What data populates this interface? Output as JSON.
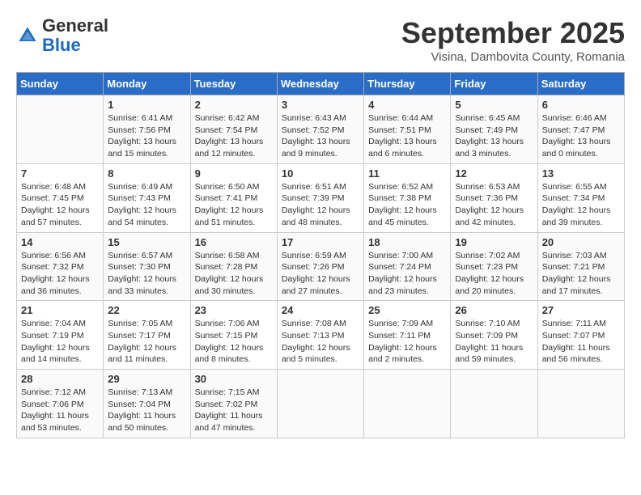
{
  "header": {
    "logo_general": "General",
    "logo_blue": "Blue",
    "month_title": "September 2025",
    "location": "Visina, Dambovita County, Romania"
  },
  "weekdays": [
    "Sunday",
    "Monday",
    "Tuesday",
    "Wednesday",
    "Thursday",
    "Friday",
    "Saturday"
  ],
  "weeks": [
    [
      {
        "day": "",
        "empty": true
      },
      {
        "day": "1",
        "sunrise": "Sunrise: 6:41 AM",
        "sunset": "Sunset: 7:56 PM",
        "daylight": "Daylight: 13 hours and 15 minutes."
      },
      {
        "day": "2",
        "sunrise": "Sunrise: 6:42 AM",
        "sunset": "Sunset: 7:54 PM",
        "daylight": "Daylight: 13 hours and 12 minutes."
      },
      {
        "day": "3",
        "sunrise": "Sunrise: 6:43 AM",
        "sunset": "Sunset: 7:52 PM",
        "daylight": "Daylight: 13 hours and 9 minutes."
      },
      {
        "day": "4",
        "sunrise": "Sunrise: 6:44 AM",
        "sunset": "Sunset: 7:51 PM",
        "daylight": "Daylight: 13 hours and 6 minutes."
      },
      {
        "day": "5",
        "sunrise": "Sunrise: 6:45 AM",
        "sunset": "Sunset: 7:49 PM",
        "daylight": "Daylight: 13 hours and 3 minutes."
      },
      {
        "day": "6",
        "sunrise": "Sunrise: 6:46 AM",
        "sunset": "Sunset: 7:47 PM",
        "daylight": "Daylight: 13 hours and 0 minutes."
      }
    ],
    [
      {
        "day": "7",
        "sunrise": "Sunrise: 6:48 AM",
        "sunset": "Sunset: 7:45 PM",
        "daylight": "Daylight: 12 hours and 57 minutes."
      },
      {
        "day": "8",
        "sunrise": "Sunrise: 6:49 AM",
        "sunset": "Sunset: 7:43 PM",
        "daylight": "Daylight: 12 hours and 54 minutes."
      },
      {
        "day": "9",
        "sunrise": "Sunrise: 6:50 AM",
        "sunset": "Sunset: 7:41 PM",
        "daylight": "Daylight: 12 hours and 51 minutes."
      },
      {
        "day": "10",
        "sunrise": "Sunrise: 6:51 AM",
        "sunset": "Sunset: 7:39 PM",
        "daylight": "Daylight: 12 hours and 48 minutes."
      },
      {
        "day": "11",
        "sunrise": "Sunrise: 6:52 AM",
        "sunset": "Sunset: 7:38 PM",
        "daylight": "Daylight: 12 hours and 45 minutes."
      },
      {
        "day": "12",
        "sunrise": "Sunrise: 6:53 AM",
        "sunset": "Sunset: 7:36 PM",
        "daylight": "Daylight: 12 hours and 42 minutes."
      },
      {
        "day": "13",
        "sunrise": "Sunrise: 6:55 AM",
        "sunset": "Sunset: 7:34 PM",
        "daylight": "Daylight: 12 hours and 39 minutes."
      }
    ],
    [
      {
        "day": "14",
        "sunrise": "Sunrise: 6:56 AM",
        "sunset": "Sunset: 7:32 PM",
        "daylight": "Daylight: 12 hours and 36 minutes."
      },
      {
        "day": "15",
        "sunrise": "Sunrise: 6:57 AM",
        "sunset": "Sunset: 7:30 PM",
        "daylight": "Daylight: 12 hours and 33 minutes."
      },
      {
        "day": "16",
        "sunrise": "Sunrise: 6:58 AM",
        "sunset": "Sunset: 7:28 PM",
        "daylight": "Daylight: 12 hours and 30 minutes."
      },
      {
        "day": "17",
        "sunrise": "Sunrise: 6:59 AM",
        "sunset": "Sunset: 7:26 PM",
        "daylight": "Daylight: 12 hours and 27 minutes."
      },
      {
        "day": "18",
        "sunrise": "Sunrise: 7:00 AM",
        "sunset": "Sunset: 7:24 PM",
        "daylight": "Daylight: 12 hours and 23 minutes."
      },
      {
        "day": "19",
        "sunrise": "Sunrise: 7:02 AM",
        "sunset": "Sunset: 7:23 PM",
        "daylight": "Daylight: 12 hours and 20 minutes."
      },
      {
        "day": "20",
        "sunrise": "Sunrise: 7:03 AM",
        "sunset": "Sunset: 7:21 PM",
        "daylight": "Daylight: 12 hours and 17 minutes."
      }
    ],
    [
      {
        "day": "21",
        "sunrise": "Sunrise: 7:04 AM",
        "sunset": "Sunset: 7:19 PM",
        "daylight": "Daylight: 12 hours and 14 minutes."
      },
      {
        "day": "22",
        "sunrise": "Sunrise: 7:05 AM",
        "sunset": "Sunset: 7:17 PM",
        "daylight": "Daylight: 12 hours and 11 minutes."
      },
      {
        "day": "23",
        "sunrise": "Sunrise: 7:06 AM",
        "sunset": "Sunset: 7:15 PM",
        "daylight": "Daylight: 12 hours and 8 minutes."
      },
      {
        "day": "24",
        "sunrise": "Sunrise: 7:08 AM",
        "sunset": "Sunset: 7:13 PM",
        "daylight": "Daylight: 12 hours and 5 minutes."
      },
      {
        "day": "25",
        "sunrise": "Sunrise: 7:09 AM",
        "sunset": "Sunset: 7:11 PM",
        "daylight": "Daylight: 12 hours and 2 minutes."
      },
      {
        "day": "26",
        "sunrise": "Sunrise: 7:10 AM",
        "sunset": "Sunset: 7:09 PM",
        "daylight": "Daylight: 11 hours and 59 minutes."
      },
      {
        "day": "27",
        "sunrise": "Sunrise: 7:11 AM",
        "sunset": "Sunset: 7:07 PM",
        "daylight": "Daylight: 11 hours and 56 minutes."
      }
    ],
    [
      {
        "day": "28",
        "sunrise": "Sunrise: 7:12 AM",
        "sunset": "Sunset: 7:06 PM",
        "daylight": "Daylight: 11 hours and 53 minutes."
      },
      {
        "day": "29",
        "sunrise": "Sunrise: 7:13 AM",
        "sunset": "Sunset: 7:04 PM",
        "daylight": "Daylight: 11 hours and 50 minutes."
      },
      {
        "day": "30",
        "sunrise": "Sunrise: 7:15 AM",
        "sunset": "Sunset: 7:02 PM",
        "daylight": "Daylight: 11 hours and 47 minutes."
      },
      {
        "day": "",
        "empty": true
      },
      {
        "day": "",
        "empty": true
      },
      {
        "day": "",
        "empty": true
      },
      {
        "day": "",
        "empty": true
      }
    ]
  ]
}
